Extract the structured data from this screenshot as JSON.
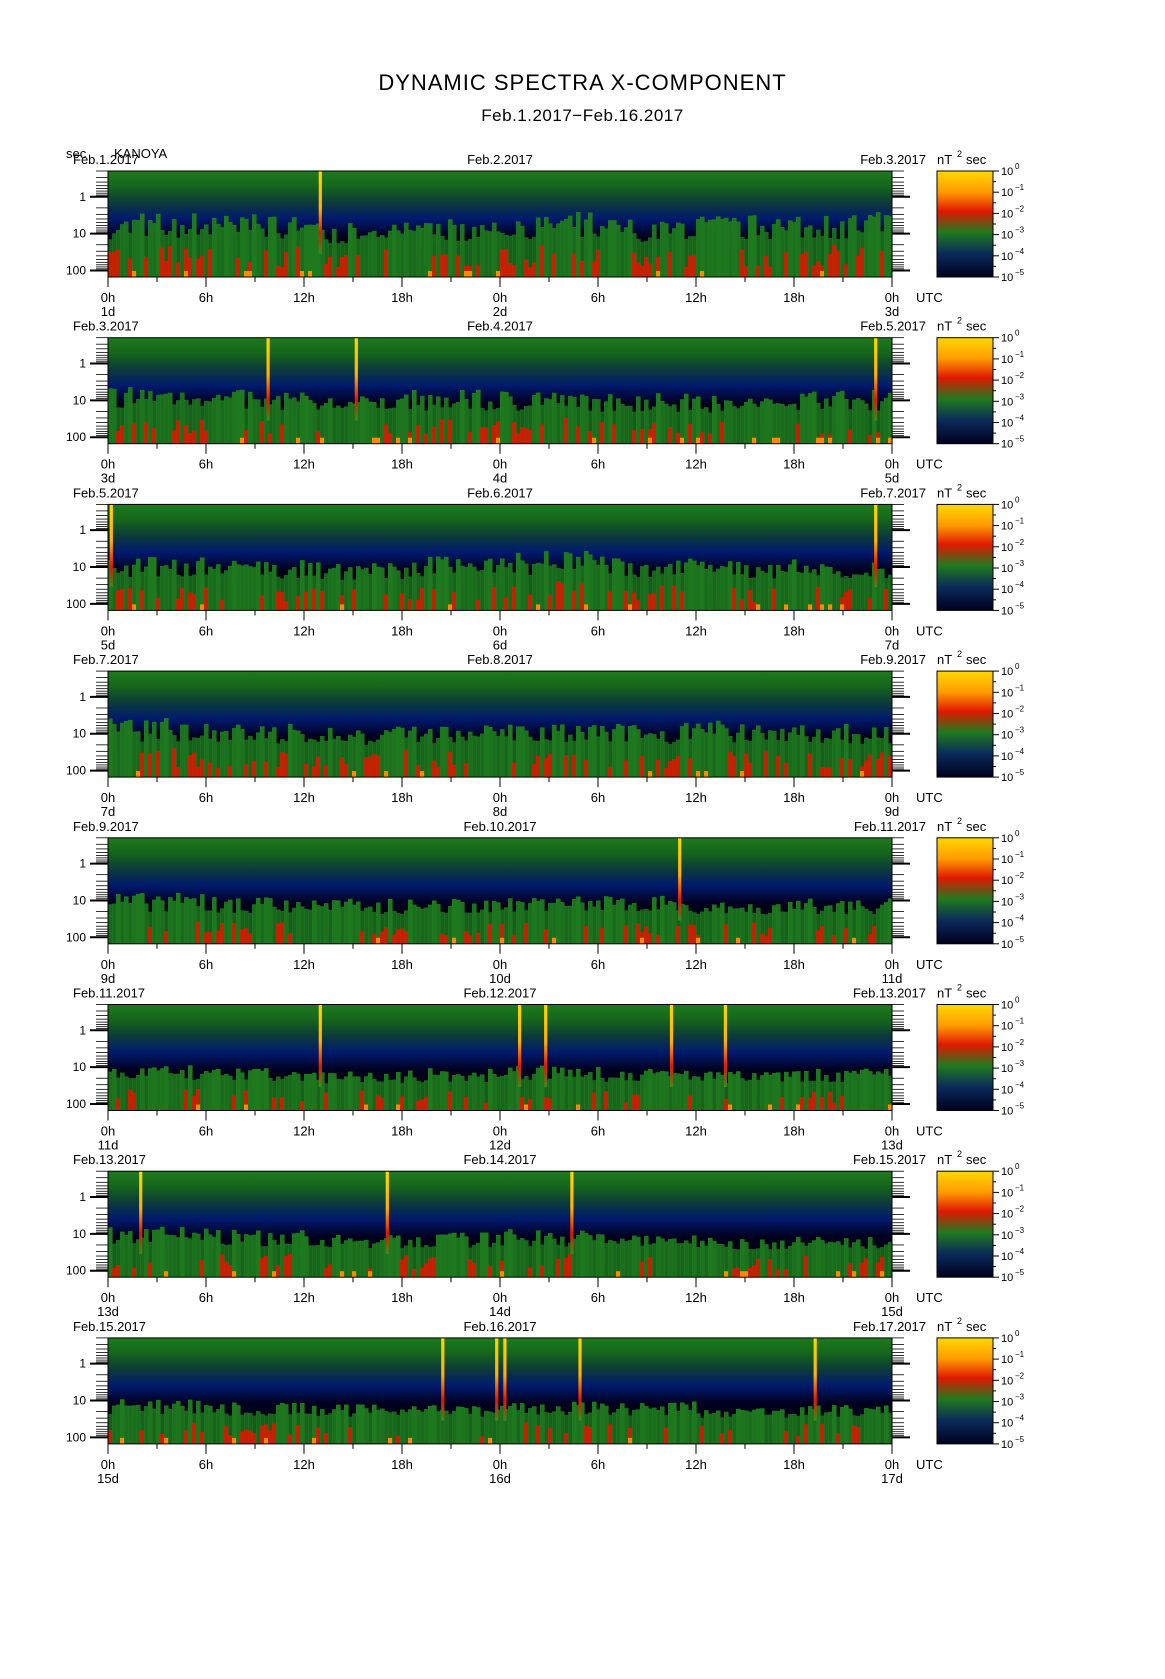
{
  "title": "DYNAMIC SPECTRA X-COMPONENT",
  "subtitle": "Feb.1.2017−Feb.16.2017",
  "ylabel": "sec",
  "station": "KANOYA",
  "unit_label_main": "nT",
  "unit_label_exp": "2",
  "unit_label_tail": "sec",
  "utc_label": "UTC",
  "colors": {
    "background_dark": "#00001e",
    "low": "#001a6e",
    "mid": "#1f7a1f",
    "high": "#e01800",
    "peak": "#ffd800"
  },
  "chart_data": {
    "type": "heatmap",
    "description_axes": "x = time (UTC, 2 days per panel), y = period in seconds (log scale, ~0.2 to ~150 s, increasing downward), color = power nT^2 sec (log scale 1e-5 to 1e0)",
    "y_ticks": [
      "1",
      "10",
      "100"
    ],
    "y_tick_values": [
      1,
      10,
      100
    ],
    "y_range": [
      0.2,
      150
    ],
    "y_scale": "log",
    "x_ticks": [
      "0h",
      "6h",
      "12h",
      "18h",
      "0h",
      "6h",
      "12h",
      "18h",
      "0h"
    ],
    "x_tick_hours": [
      0,
      6,
      12,
      18,
      24,
      30,
      36,
      42,
      48
    ],
    "colorbar": {
      "scale": "log",
      "range": [
        1e-05,
        1
      ],
      "ticks": [
        "10^0",
        "10^-1",
        "10^-2",
        "10^-3",
        "10^-4",
        "10^-5"
      ],
      "tick_bases": [
        "10",
        "10",
        "10",
        "10",
        "10",
        "10"
      ],
      "tick_exps": [
        "0",
        "−1",
        "−2",
        "−3",
        "−4",
        "−5"
      ]
    },
    "panels": [
      {
        "left_date": "Feb.1.2017",
        "mid_date": "Feb.2.2017",
        "right_date": "Feb.3.2017",
        "day_start": "1d",
        "day_mid": "2d",
        "day_end": "3d",
        "spikes_hours": [
          13.0
        ],
        "activity": [
          0.8,
          0.75,
          0.6,
          0.7,
          0.8,
          0.7,
          0.75,
          0.8
        ]
      },
      {
        "left_date": "Feb.3.2017",
        "mid_date": "Feb.4.2017",
        "right_date": "Feb.5.2017",
        "day_start": "3d",
        "day_mid": "4d",
        "day_end": "5d",
        "spikes_hours": [
          9.8,
          15.2,
          47.0
        ],
        "activity": [
          0.7,
          0.6,
          0.5,
          0.6,
          0.6,
          0.55,
          0.5,
          0.6
        ]
      },
      {
        "left_date": "Feb.5.2017",
        "mid_date": "Feb.6.2017",
        "right_date": "Feb.7.2017",
        "day_start": "5d",
        "day_mid": "6d",
        "day_end": "7d",
        "spikes_hours": [
          0.2,
          47.0
        ],
        "activity": [
          0.6,
          0.55,
          0.5,
          0.6,
          0.7,
          0.6,
          0.55,
          0.5
        ]
      },
      {
        "left_date": "Feb.7.2017",
        "mid_date": "Feb.8.2017",
        "right_date": "Feb.9.2017",
        "day_start": "7d",
        "day_mid": "8d",
        "day_end": "9d",
        "spikes_hours": [],
        "activity": [
          0.7,
          0.6,
          0.55,
          0.6,
          0.6,
          0.6,
          0.65,
          0.6
        ]
      },
      {
        "left_date": "Feb.9.2017",
        "mid_date": "Feb.10.2017",
        "right_date": "Feb.11.2017",
        "day_start": "9d",
        "day_mid": "10d",
        "day_end": "11d",
        "spikes_hours": [
          35.0
        ],
        "activity": [
          0.55,
          0.5,
          0.45,
          0.45,
          0.5,
          0.5,
          0.4,
          0.45
        ]
      },
      {
        "left_date": "Feb.11.2017",
        "mid_date": "Feb.12.2017",
        "right_date": "Feb.13.2017",
        "day_start": "11d",
        "day_mid": "12d",
        "day_end": "13d",
        "spikes_hours": [
          13.0,
          25.2,
          26.8,
          34.5,
          37.8
        ],
        "activity": [
          0.45,
          0.4,
          0.35,
          0.4,
          0.45,
          0.4,
          0.35,
          0.4
        ]
      },
      {
        "left_date": "Feb.13.2017",
        "mid_date": "Feb.14.2017",
        "right_date": "Feb.15.2017",
        "day_start": "13d",
        "day_mid": "14d",
        "day_end": "15d",
        "spikes_hours": [
          2.0,
          17.1,
          28.4
        ],
        "activity": [
          0.55,
          0.5,
          0.4,
          0.45,
          0.5,
          0.45,
          0.35,
          0.4
        ]
      },
      {
        "left_date": "Feb.15.2017",
        "mid_date": "Feb.16.2017",
        "right_date": "Feb.17.2017",
        "day_start": "15d",
        "day_mid": "16d",
        "day_end": "17d",
        "spikes_hours": [
          20.5,
          23.8,
          24.3,
          28.9,
          43.3
        ],
        "activity": [
          0.45,
          0.4,
          0.35,
          0.35,
          0.4,
          0.4,
          0.3,
          0.35
        ]
      }
    ]
  }
}
